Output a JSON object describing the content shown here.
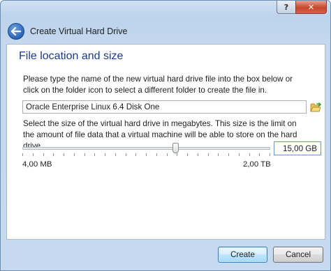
{
  "window": {
    "title_controls": {
      "help": "?",
      "close": "✕"
    }
  },
  "header": {
    "title": "Create Virtual Hard Drive"
  },
  "page": {
    "title": "File location and size",
    "location_description": "Please type the name of the new virtual hard drive file into the box below or click on the folder icon to select a different folder to create the file in.",
    "file_name_value": "Oracle Enterprise Linux 6.4 Disk One",
    "size_description": "Select the size of the virtual hard drive in megabytes. This size is the limit on the amount of file data that a virtual machine will be able to store on the hard drive.",
    "size_slider": {
      "position_fraction": 0.62,
      "min_label": "4,00 MB",
      "max_label": "2,00 TB"
    },
    "size_value": "15,00 GB"
  },
  "footer": {
    "create_label": "Create",
    "cancel_label": "Cancel"
  },
  "icons": {
    "back": "back-arrow-icon",
    "folder": "folder-open-icon",
    "help": "help-icon",
    "close": "close-icon"
  },
  "colors": {
    "title_blue": "#1b3a8a",
    "accent_button": "#3c7fb1",
    "close_red": "#c7462f"
  }
}
